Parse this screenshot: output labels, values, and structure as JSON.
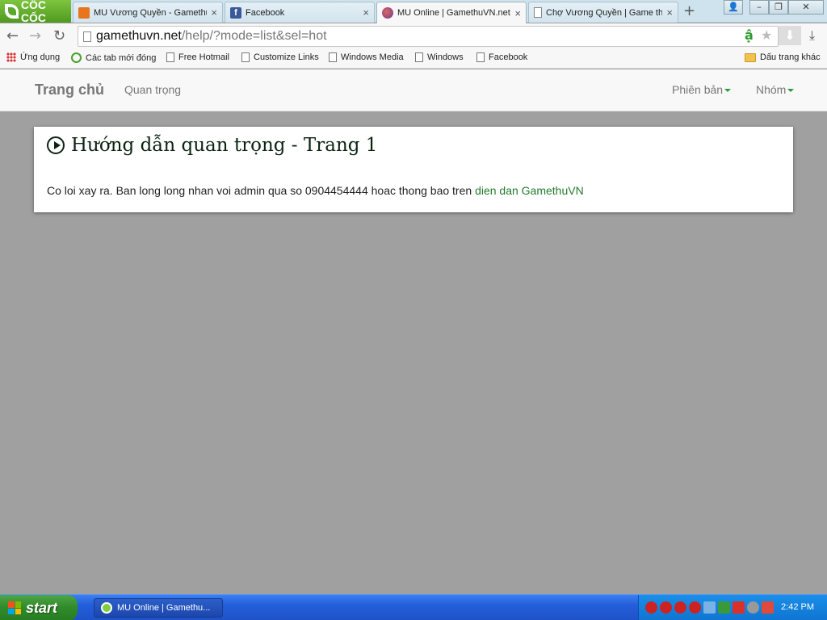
{
  "browser": {
    "brand": "CỐC CỐC",
    "tabs": [
      {
        "title": "MU Vương Quyền - Gamethu",
        "icon": "crown-icon",
        "active": false
      },
      {
        "title": "Facebook",
        "icon": "facebook-icon",
        "active": false
      },
      {
        "title": "MU Online | GamethuVN.net",
        "icon": "mu-icon",
        "active": true
      },
      {
        "title": "Chợ Vương Quyền | Game th",
        "icon": "page-icon",
        "active": false
      }
    ],
    "tab_close": "×",
    "new_tab": "+",
    "window_controls": {
      "user": "👤",
      "minimize": "–",
      "restore": "❐",
      "close": "✕"
    },
    "url_host": "gamethuvn.net",
    "url_path": "/help/?mode=list&sel=hot",
    "back": "←",
    "forward": "→",
    "reload": "↻",
    "omni_a": "ậ",
    "star": "★",
    "download_arrow": "⬇",
    "download": "⤓"
  },
  "bookmarks": [
    {
      "label": "Ứng dụng",
      "icon": "apps-grid-icon"
    },
    {
      "label": "Các tab mới đóng",
      "icon": "recent-tabs-icon"
    },
    {
      "label": "Free Hotmail",
      "icon": "page-icon"
    },
    {
      "label": "Customize Links",
      "icon": "page-icon"
    },
    {
      "label": "Windows Media",
      "icon": "page-icon"
    },
    {
      "label": "Windows",
      "icon": "page-icon"
    },
    {
      "label": "Facebook",
      "icon": "page-icon"
    }
  ],
  "other_bookmarks": "Dấu trang khác",
  "site": {
    "brand": "Trang chủ",
    "link_important": "Quan trọng",
    "menu_version": "Phiên bản",
    "menu_group": "Nhóm"
  },
  "panel": {
    "title": "Hướng dẫn quan trọng - Trang 1",
    "message": "Co loi xay ra. Ban long long nhan voi admin qua so 0904454444 hoac thong bao tren ",
    "forum_link": "dien dan GamethuVN"
  },
  "taskbar": {
    "start": "start",
    "task": "MU Online | Gamethu...",
    "clock": "2:42 PM"
  },
  "colors": {
    "accent_green": "#237a2f",
    "page_background": "#a0a0a0",
    "taskbar_blue": "#245edb"
  }
}
